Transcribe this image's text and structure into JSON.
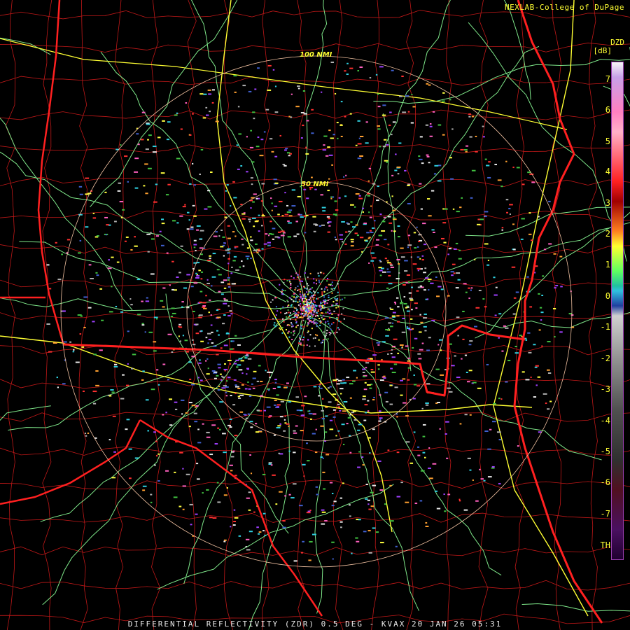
{
  "credit": "NEXLAB-College of DuPage",
  "footer": "DIFFERENTIAL REFLECTIVITY (ZDR) 0.5 DEG - KVAX 20 JAN 26 05:31",
  "legend": {
    "product": "DZD",
    "unit": "[dB]",
    "ticks": [
      "7",
      "6",
      "5",
      "4",
      "3",
      "2",
      "1",
      "0",
      "-1",
      "-2",
      "-3",
      "-4",
      "-5",
      "-6",
      "-7",
      "TH"
    ]
  },
  "range_rings": [
    {
      "label": "50 NMI",
      "range_nmi": 50
    },
    {
      "label": "100 NMI",
      "range_nmi": 100
    }
  ],
  "colors": {
    "state_borders": "#ff2020",
    "county_borders": "#c01818",
    "highways": "#ffff33",
    "roads": "#7fe88a",
    "range_ring": "#f0c0a0",
    "text": "#ffff33"
  }
}
